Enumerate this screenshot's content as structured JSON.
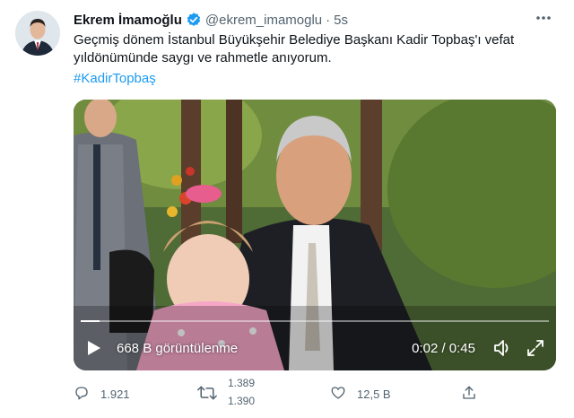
{
  "author": {
    "name": "Ekrem İmamoğlu",
    "handle": "@ekrem_imamoglu",
    "time": "5s"
  },
  "tweet": {
    "text": "Geçmiş dönem İstanbul Büyükşehir Belediye Başkanı Kadir Topbaş'ı vefat yıldönümünde saygı ve rahmetle anıyorum.",
    "hashtag": "#KadirTopbaş"
  },
  "video": {
    "views": "668 B görüntülenme",
    "timecode": "0:02 / 0:45",
    "progress": 0.04
  },
  "actions": {
    "reply_count": "1.921",
    "retweet_count_old": "1.389",
    "retweet_count_new": "1.390",
    "like_count": "12,5 B"
  },
  "icons": {
    "more": "more-icon",
    "verified": "verified-badge-icon",
    "play": "play-icon",
    "volume": "volume-icon",
    "fullscreen": "fullscreen-icon",
    "reply": "reply-icon",
    "retweet": "retweet-icon",
    "like": "like-icon",
    "share": "share-icon"
  },
  "colors": {
    "accent": "#1d9bf0",
    "muted": "#536471",
    "text": "#0f1419"
  }
}
